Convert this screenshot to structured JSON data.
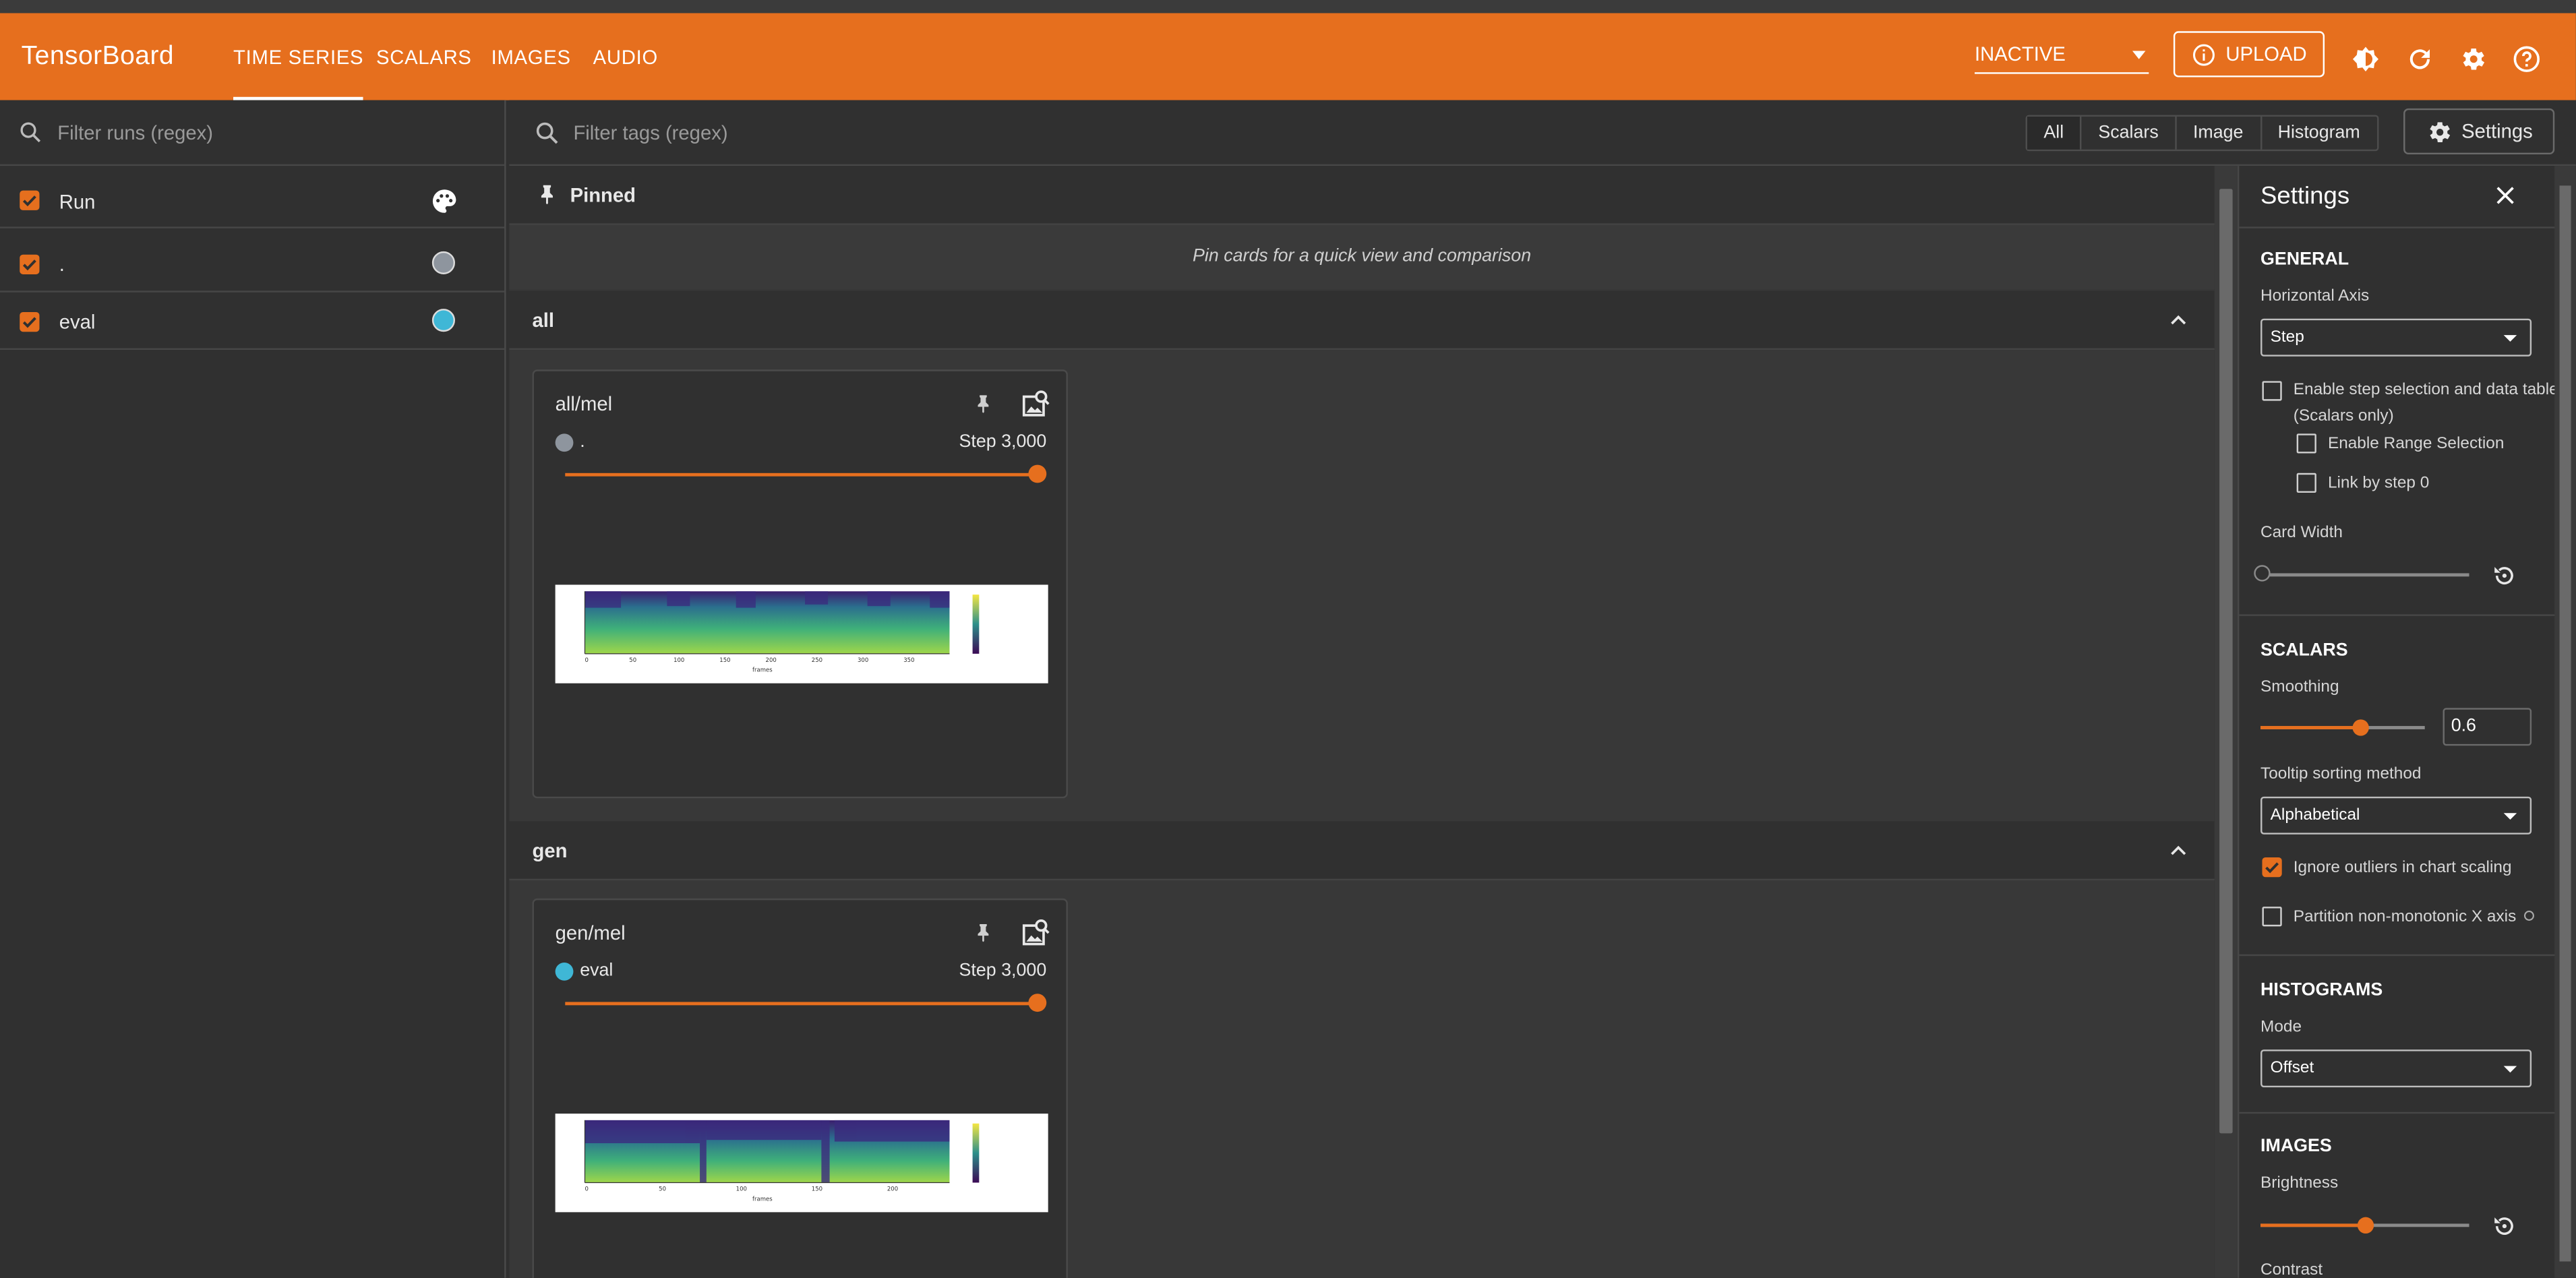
{
  "colors": {
    "accent": "#e66f1e",
    "run_dot_default": "#8e959e",
    "run_dot_eval": "#3fb7d6"
  },
  "header": {
    "brand": "TensorBoard",
    "tabs": [
      "TIME SERIES",
      "SCALARS",
      "IMAGES",
      "AUDIO"
    ],
    "active_tab": "TIME SERIES",
    "status": "INACTIVE",
    "upload_label": "UPLOAD",
    "icons": [
      "info-icon",
      "brightness-icon",
      "refresh-icon",
      "settings-icon",
      "help-icon"
    ]
  },
  "runs": {
    "filter_placeholder": "Filter runs (regex)",
    "header_label": "Run",
    "items": [
      {
        "name": ".",
        "checked": true,
        "color": "#8e959e"
      },
      {
        "name": "eval",
        "checked": true,
        "color": "#3fb7d6"
      }
    ]
  },
  "toolbar": {
    "filter_placeholder": "Filter tags (regex)",
    "type_filters": [
      "All",
      "Scalars",
      "Image",
      "Histogram"
    ],
    "active_type": "All",
    "settings_label": "Settings"
  },
  "pinned": {
    "title": "Pinned",
    "empty_text": "Pin cards for a quick view and comparison"
  },
  "groups": [
    {
      "name": "all",
      "card": {
        "title": "all/mel",
        "run": ".",
        "step": "Step 3,000",
        "slider_fraction": 1.0
      }
    },
    {
      "name": "gen",
      "card": {
        "title": "gen/mel",
        "run": "eval",
        "step": "Step 3,000",
        "slider_fraction": 1.0
      }
    }
  ],
  "settings": {
    "title": "Settings",
    "general": {
      "heading": "GENERAL",
      "horizontal_axis_label": "Horizontal Axis",
      "horizontal_axis_value": "Step",
      "step_selection_label": "Enable step selection and data table",
      "step_selection_note": "(Scalars only)",
      "step_selection_checked": false,
      "range_selection_label": "Enable Range Selection",
      "range_selection_checked": false,
      "link_step_label": "Link by step 0",
      "link_step_checked": false,
      "card_width_label": "Card Width",
      "card_width_fraction": 0.0
    },
    "scalars": {
      "heading": "SCALARS",
      "smoothing_label": "Smoothing",
      "smoothing_value": "0.6",
      "smoothing_fraction": 0.6,
      "tooltip_label": "Tooltip sorting method",
      "tooltip_value": "Alphabetical",
      "ignore_outliers_label": "Ignore outliers in chart scaling",
      "ignore_outliers_checked": true,
      "partition_label": "Partition non-monotonic X axis",
      "partition_checked": false
    },
    "histograms": {
      "heading": "HISTOGRAMS",
      "mode_label": "Mode",
      "mode_value": "Offset"
    },
    "images": {
      "heading": "IMAGES",
      "brightness_label": "Brightness",
      "brightness_fraction": 0.5,
      "contrast_label": "Contrast"
    }
  }
}
